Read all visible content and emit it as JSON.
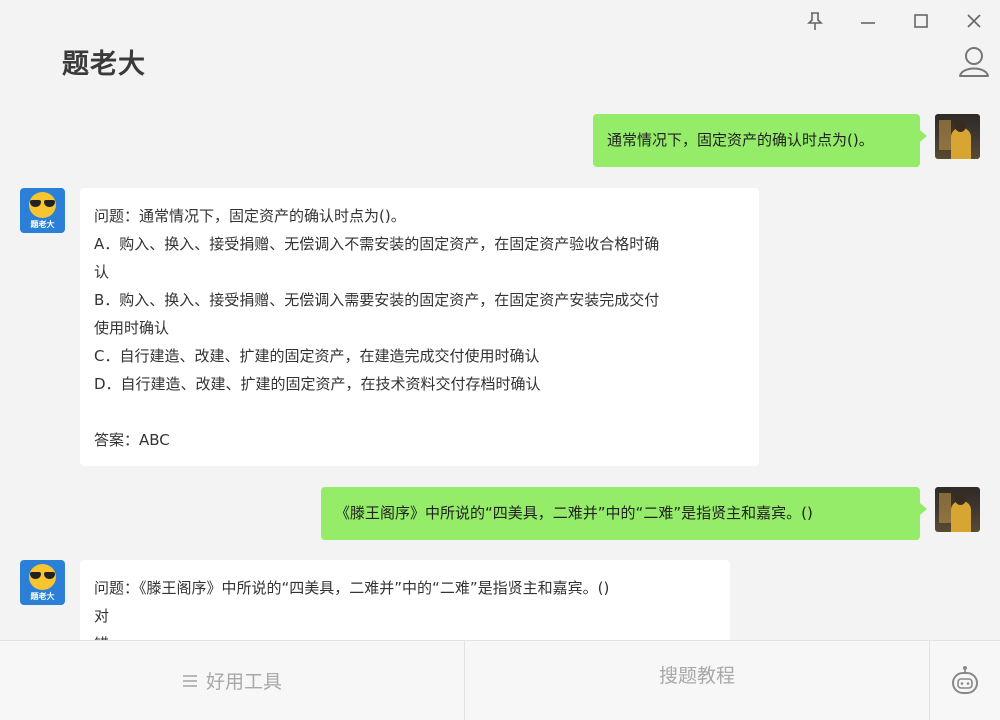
{
  "app": {
    "title": "题老大"
  },
  "bot_avatar_label": "题老大",
  "messages": [
    {
      "role": "user",
      "text": "通常情况下，固定资产的确认时点为()。"
    },
    {
      "role": "bot",
      "lines": [
        "问题：通常情况下，固定资产的确认时点为()。",
        "A．购入、换入、接受捐赠、无偿调入不需安装的固定资产，在固定资产验收合格时确",
        "认",
        "B．购入、换入、接受捐赠、无偿调入需要安装的固定资产，在固定资产安装完成交付",
        "使用时确认",
        "C．自行建造、改建、扩建的固定资产，在建造完成交付使用时确认",
        "D．自行建造、改建、扩建的固定资产，在技术资料交付存档时确认",
        "",
        "答案：ABC"
      ]
    },
    {
      "role": "user",
      "text": "《滕王阁序》中所说的“四美具，二难并”中的“二难”是指贤主和嘉宾。()"
    },
    {
      "role": "bot",
      "lines": [
        "问题：《滕王阁序》中所说的“四美具，二难并”中的“二难”是指贤主和嘉宾。()",
        "对",
        "错"
      ]
    }
  ],
  "bottom": {
    "tools_label": "好用工具",
    "tutorial_label": "搜题教程"
  },
  "icons": {
    "pin": "pin-icon",
    "minimize": "minimize-icon",
    "maximize": "maximize-icon",
    "close": "close-icon",
    "user": "user-icon",
    "menu": "menu-icon",
    "robot": "robot-icon"
  },
  "colors": {
    "user_bubble": "#95ec69",
    "bot_bubble": "#ffffff",
    "background": "#f3f3f3",
    "bot_avatar": "#2b7fd6"
  }
}
